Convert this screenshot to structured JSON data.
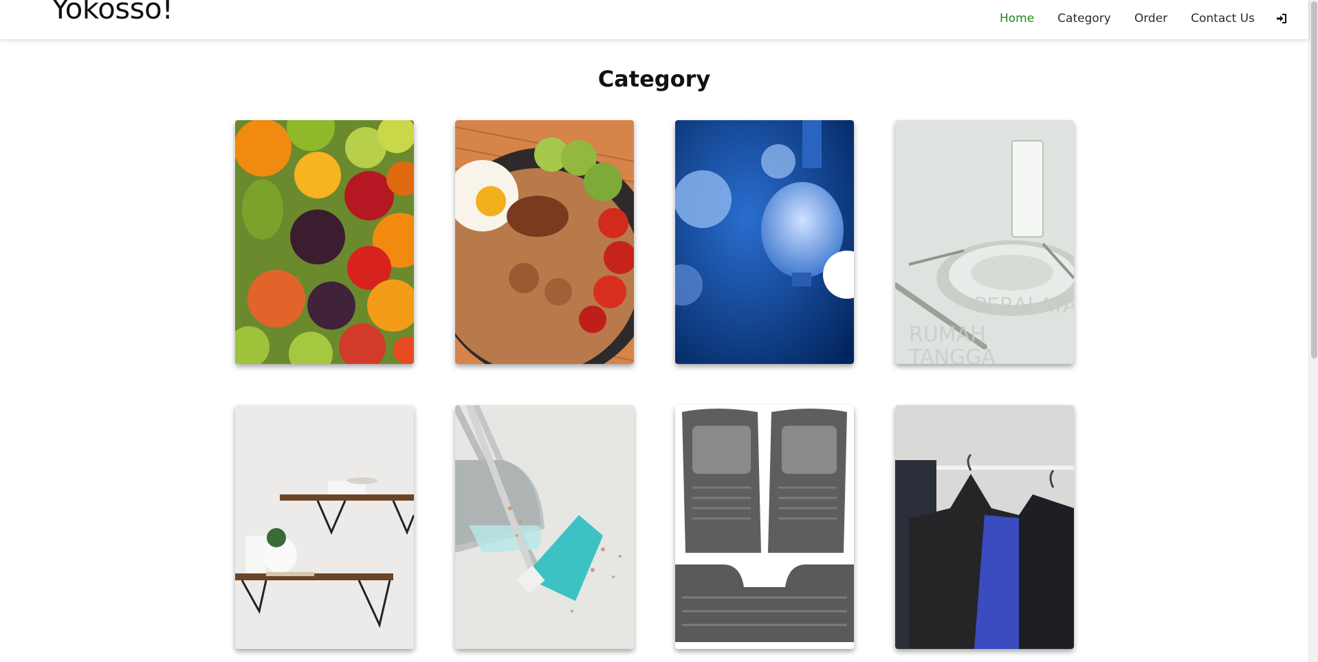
{
  "navbar": {
    "brand": "Yokosso!",
    "links": [
      {
        "label": "Home",
        "active": true
      },
      {
        "label": "Category",
        "active": false
      },
      {
        "label": "Order",
        "active": false
      },
      {
        "label": "Contact Us",
        "active": false
      }
    ],
    "login_icon": "sign-in-icon",
    "active_color": "#1a8a1a"
  },
  "main": {
    "title": "Category",
    "categories": [
      {
        "image": "fruits-image"
      },
      {
        "image": "fried-rice-image"
      },
      {
        "image": "light-bulb-image"
      },
      {
        "image": "tableware-image",
        "watermark": "PERALATAN RUMAH TANGGA"
      },
      {
        "image": "wall-shelves-image"
      },
      {
        "image": "broom-dustpan-image"
      },
      {
        "image": "car-floor-mats-image"
      },
      {
        "image": "clothes-rack-image"
      }
    ]
  }
}
